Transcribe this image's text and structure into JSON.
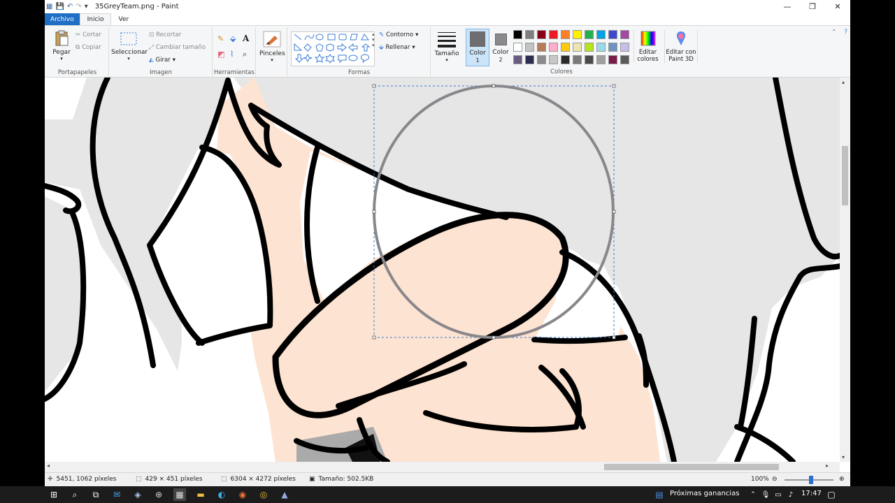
{
  "window": {
    "title": "35GreyTeam.png - Paint",
    "controls": {
      "minimize": "—",
      "maximize": "❐",
      "close": "✕"
    }
  },
  "tabs": [
    "Archivo",
    "Inicio",
    "Ver"
  ],
  "ribbon": {
    "clipboard": {
      "label": "Portapapeles",
      "paste": "Pegar",
      "cut": "Cortar",
      "copy": "Copiar"
    },
    "image": {
      "label": "Imagen",
      "select": "Seleccionar",
      "crop": "Recortar",
      "resize": "Cambiar tamaño",
      "rotate": "Girar"
    },
    "tools": {
      "label": "Herramientas"
    },
    "brushes": {
      "label": "Pinceles"
    },
    "shapes": {
      "label": "Formas",
      "outline": "Contorno",
      "fill": "Rellenar"
    },
    "size": {
      "label": "Tamaño"
    },
    "color1": {
      "label": "Color",
      "sub": "1",
      "value": "#6e6e72"
    },
    "color2": {
      "label": "Color",
      "sub": "2",
      "value": "#8a8a8e"
    },
    "colors": {
      "label": "Colores",
      "row1": [
        "#000000",
        "#7f7f7f",
        "#880015",
        "#ed1c24",
        "#ff7f27",
        "#fff200",
        "#22b14c",
        "#00a2e8",
        "#3f48cc",
        "#a349a4"
      ],
      "row2": [
        "#ffffff",
        "#c3c3c3",
        "#b97a57",
        "#ffaec9",
        "#ffc90e",
        "#efe4b0",
        "#b5e61d",
        "#99d9ea",
        "#7092be",
        "#c8bfe7"
      ],
      "row3": [
        "#6a5a82",
        "#2c2c50",
        "#8a8a8e",
        "#c8c8c8",
        "#2a2a2a",
        "#7a7a7a",
        "#4a4a4a",
        "#a0a0a0",
        "#7a1a4a",
        "#5a5a5a"
      ]
    },
    "edit_colors": "Editar colores",
    "paint3d": "Editar con Paint 3D"
  },
  "status": {
    "cursor": "5451, 1062 píxeles",
    "selection": "429 × 451 píxeles",
    "image_size": "6304 × 4272 píxeles",
    "file_size": "Tamaño: 502.5KB",
    "zoom": "100%",
    "zoom_level": 0.55
  },
  "taskbar": {
    "notification": "Próximas ganancias",
    "time": "17:47"
  }
}
